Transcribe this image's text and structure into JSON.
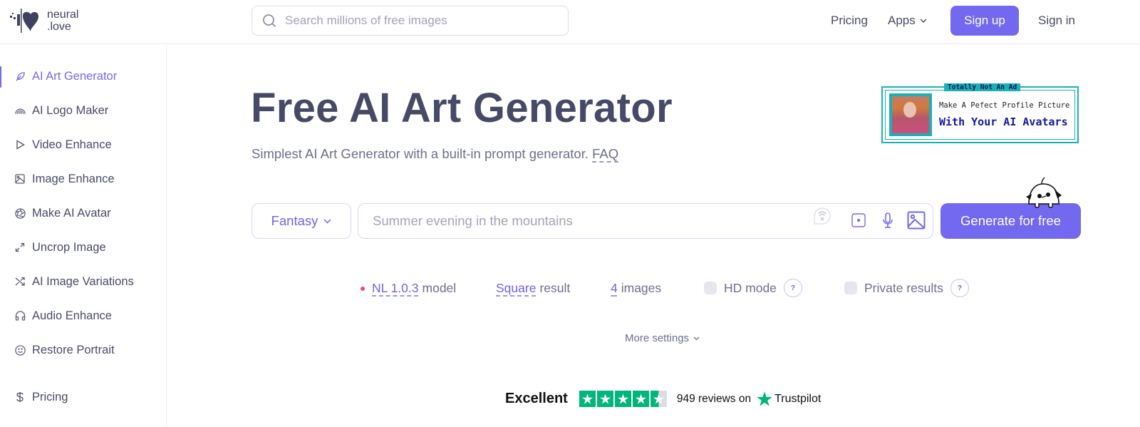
{
  "header": {
    "logo_line1": "neural",
    "logo_line2": ".love",
    "search_placeholder": "Search millions of free images",
    "nav": {
      "pricing": "Pricing",
      "apps": "Apps",
      "signup": "Sign up",
      "signin": "Sign in"
    }
  },
  "sidebar": {
    "items": [
      {
        "label": "AI Art Generator",
        "icon": "feather-icon",
        "active": true
      },
      {
        "label": "AI Logo Maker",
        "icon": "rainbow-icon"
      },
      {
        "label": "Video Enhance",
        "icon": "play-icon"
      },
      {
        "label": "Image Enhance",
        "icon": "image-icon"
      },
      {
        "label": "Make AI Avatar",
        "icon": "aperture-icon"
      },
      {
        "label": "Uncrop Image",
        "icon": "expand-icon"
      },
      {
        "label": "AI Image Variations",
        "icon": "shuffle-icon"
      },
      {
        "label": "Audio Enhance",
        "icon": "headphones-icon"
      },
      {
        "label": "Restore Portrait",
        "icon": "smile-icon"
      },
      {
        "label": "Pricing",
        "icon": "dollar-icon"
      }
    ]
  },
  "hero": {
    "title": "Free AI Art Generator",
    "subtitle": "Simplest AI Art Generator with a built-in prompt generator.",
    "faq": "FAQ"
  },
  "ad": {
    "label": "Totally Not An Ad",
    "line1": "Make A Pefect Profile Picture",
    "line2": "With Your AI Avatars",
    "accent": "#1ab1b4"
  },
  "prompt": {
    "style": "Fantasy",
    "placeholder": "Summer evening in the mountains",
    "generate": "Generate for free"
  },
  "options": {
    "model_value": "NL 1.0.3",
    "model_suffix": "model",
    "shape_value": "Square",
    "shape_suffix": "result",
    "count_value": "4",
    "count_suffix": "images",
    "hd_label": "HD mode",
    "private_label": "Private results",
    "help": "?",
    "more_settings": "More settings"
  },
  "trustpilot": {
    "rating_text": "Excellent",
    "stars": 4.5,
    "reviews": "949 reviews on",
    "brand": "Trustpilot"
  },
  "colors": {
    "accent": "#7269f0",
    "trustpilot_green": "#00b67a",
    "status_dot": "#ec4c6e"
  }
}
